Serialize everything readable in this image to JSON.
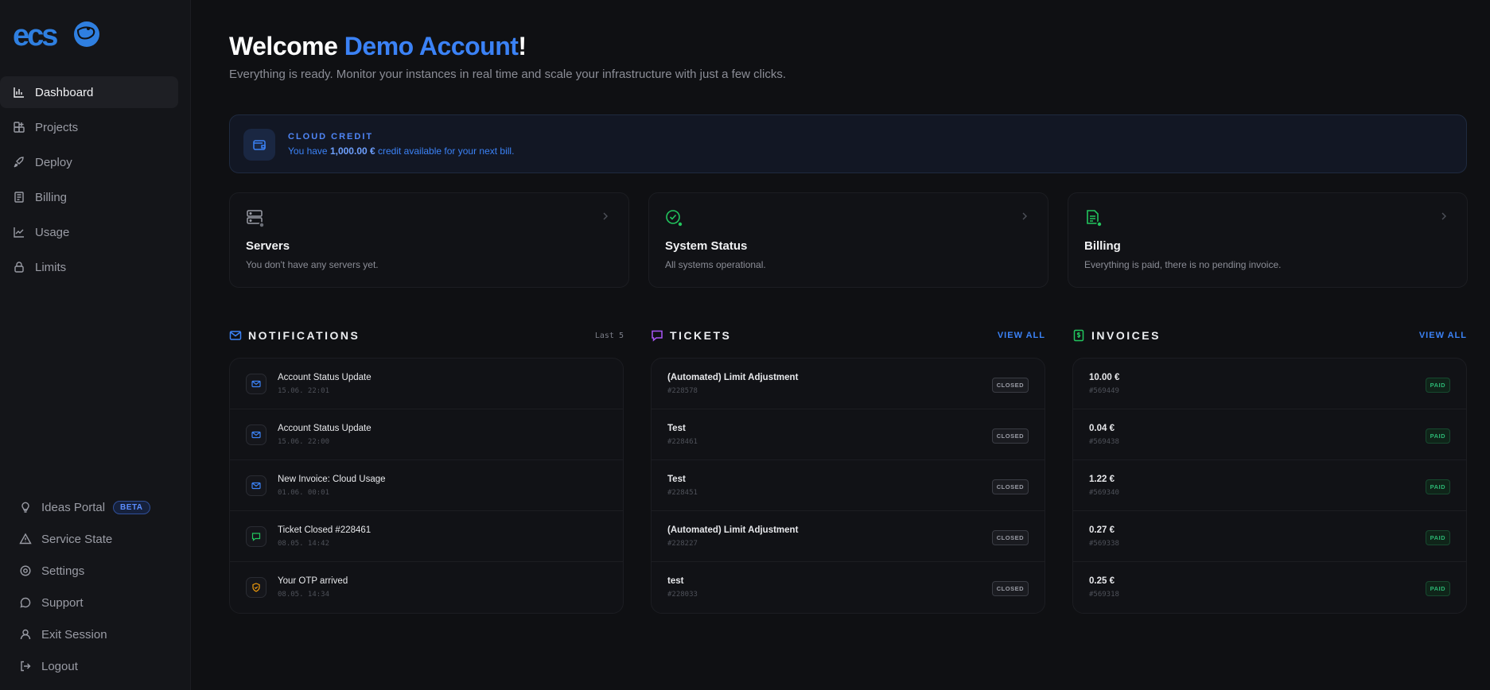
{
  "sidebar": {
    "logo_text": "ecs",
    "nav": [
      {
        "label": "Dashboard",
        "icon": "bar-chart-icon",
        "active": true
      },
      {
        "label": "Projects",
        "icon": "grid-plus-icon"
      },
      {
        "label": "Deploy",
        "icon": "rocket-icon"
      },
      {
        "label": "Billing",
        "icon": "receipt-icon"
      },
      {
        "label": "Usage",
        "icon": "line-chart-icon"
      },
      {
        "label": "Limits",
        "icon": "lock-icon"
      }
    ],
    "bottom": [
      {
        "label": "Ideas Portal",
        "icon": "lightbulb-icon",
        "badge": "BETA"
      },
      {
        "label": "Service State",
        "icon": "warning-icon"
      },
      {
        "label": "Settings",
        "icon": "gear-icon"
      },
      {
        "label": "Support",
        "icon": "chat-icon"
      },
      {
        "label": "Exit Session",
        "icon": "user-icon"
      },
      {
        "label": "Logout",
        "icon": "logout-icon"
      }
    ]
  },
  "header": {
    "welcome": "Welcome ",
    "account": "Demo Account",
    "exclaim": "!",
    "subtitle": "Everything is ready. Monitor your instances in real time and scale your infrastructure with just a few clicks."
  },
  "credit": {
    "label": "CLOUD CREDIT",
    "prefix": "You have ",
    "amount": "1,000.00 €",
    "suffix": " credit available for your next bill."
  },
  "cards": [
    {
      "title": "Servers",
      "desc": "You don't have any servers yet.",
      "icon": "server-icon"
    },
    {
      "title": "System Status",
      "desc": "All systems operational.",
      "icon": "check-circle-icon"
    },
    {
      "title": "Billing",
      "desc": "Everything is paid, there is no pending invoice.",
      "icon": "document-icon"
    }
  ],
  "notifications": {
    "title": "NOTIFICATIONS",
    "right": "Last 5",
    "items": [
      {
        "title": "Account Status Update",
        "time": "15.06. 22:01",
        "icon": "mail-icon"
      },
      {
        "title": "Account Status Update",
        "time": "15.06. 22:00",
        "icon": "mail-icon"
      },
      {
        "title": "New Invoice: Cloud Usage",
        "time": "01.06. 00:01",
        "icon": "mail-icon"
      },
      {
        "title": "Ticket Closed #228461",
        "time": "08.05. 14:42",
        "icon": "chat-icon"
      },
      {
        "title": "Your OTP arrived",
        "time": "08.05. 14:34",
        "icon": "shield-icon"
      }
    ]
  },
  "tickets": {
    "title": "TICKETS",
    "right": "VIEW ALL",
    "items": [
      {
        "title": "(Automated) Limit Adjustment",
        "id": "#228578",
        "status": "CLOSED"
      },
      {
        "title": "Test",
        "id": "#228461",
        "status": "CLOSED"
      },
      {
        "title": "Test",
        "id": "#228451",
        "status": "CLOSED"
      },
      {
        "title": "(Automated) Limit Adjustment",
        "id": "#228227",
        "status": "CLOSED"
      },
      {
        "title": "test",
        "id": "#228033",
        "status": "CLOSED"
      }
    ]
  },
  "invoices": {
    "title": "INVOICES",
    "right": "VIEW ALL",
    "items": [
      {
        "amount": "10.00 €",
        "id": "#569449",
        "status": "PAID"
      },
      {
        "amount": "0.04 €",
        "id": "#569438",
        "status": "PAID"
      },
      {
        "amount": "1.22 €",
        "id": "#569340",
        "status": "PAID"
      },
      {
        "amount": "0.27 €",
        "id": "#569338",
        "status": "PAID"
      },
      {
        "amount": "0.25 €",
        "id": "#569318",
        "status": "PAID"
      }
    ]
  },
  "colors": {
    "accent": "#3b82f6",
    "success": "#22c55e",
    "ticket": "#a855f7",
    "otp": "#f59e0b"
  }
}
